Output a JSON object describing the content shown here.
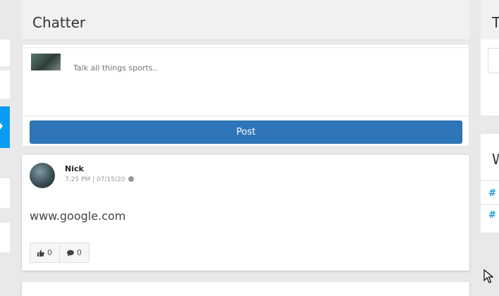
{
  "chatter": {
    "title": "Chatter",
    "composer": {
      "placeholder": "Talk all things sports..",
      "post_label": "Post"
    }
  },
  "feed": [
    {
      "author": "Nick",
      "meta": "7:25 PM | 07/15/20",
      "text": "www.google.com",
      "likes": "0",
      "comments": "0"
    }
  ],
  "right": {
    "header_initial": "T",
    "widget_initial": "W",
    "hashtags": [
      "#",
      "#"
    ]
  },
  "colors": {
    "accent_blue": "#0a9cf3",
    "button_blue": "#2f76b9",
    "hashtag_blue": "#1a9ad6"
  },
  "icons": [
    "thumbs-up-icon",
    "comment-icon",
    "globe-icon",
    "cursor-icon"
  ]
}
